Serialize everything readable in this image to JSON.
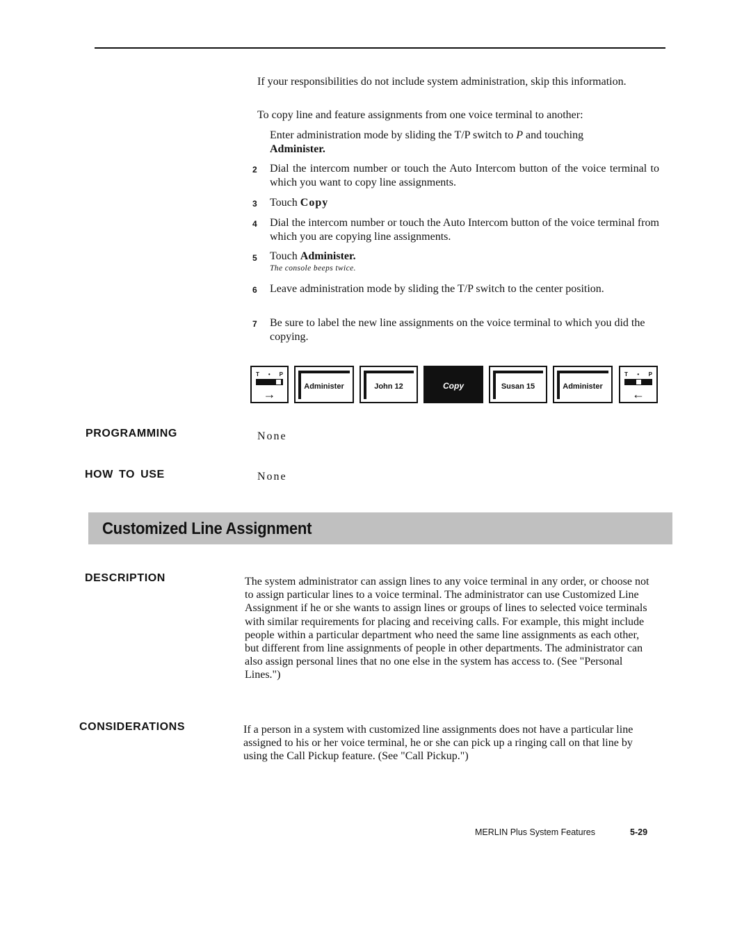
{
  "intro": {
    "skip_note": "If your responsibilities do not include system administration, skip this information.",
    "lead": "To copy line and feature assignments from one voice terminal to another:"
  },
  "steps": [
    {
      "num": "",
      "text_before": "Enter administration mode by sliding the T/P switch to ",
      "italic": "P",
      "text_after": " and  touching ",
      "bold": "Administer."
    },
    {
      "num": "2",
      "text": "Dial the intercom number or touch the Auto Intercom button of the voice terminal to which you want to copy line assignments."
    },
    {
      "num": "3",
      "prefix": "Touch ",
      "bold": "Copy"
    },
    {
      "num": "4",
      "text": "Dial the intercom number or touch the Auto Intercom button of the voice terminal from which you are copying line assignments."
    },
    {
      "num": "5",
      "prefix": "Touch ",
      "bold": "Administer.",
      "note": "The console beeps twice."
    },
    {
      "num": "6",
      "text": "Leave administration mode by sliding the T/P switch to the center position."
    },
    {
      "num": "7",
      "text": "Be sure to label the new line assignments on the voice terminal to which you did the copying."
    }
  ],
  "key_sequence": {
    "switch_labels": [
      "T",
      "•",
      "P"
    ],
    "start_switch": {
      "position": "P",
      "arrow": "→"
    },
    "buttons": [
      "Administer",
      "John 12",
      "Copy",
      "Susan 15",
      "Administer"
    ],
    "end_switch": {
      "position": "center",
      "arrow": "←"
    }
  },
  "sections": {
    "programming": {
      "label": "PROGRAMMING",
      "value": "None"
    },
    "how_to_use": {
      "label": "HOW  TO  USE",
      "value": "None"
    }
  },
  "feature": {
    "title": "Customized Line Assignment",
    "description_label": "DESCRIPTION",
    "description": "The system administrator can assign lines to any voice terminal in any order, or choose not to assign particular lines to a voice terminal. The administrator can use Customized Line Assignment if he or she wants to assign lines or groups of lines to selected voice terminals with similar requirements for placing and receiving calls. For example, this might include people within a particular department who need the same line assignments as each other, but different from line assignments of people in other departments. The administrator can also assign personal lines that no one else in the system has access to. (See \"Personal  Lines.\")",
    "considerations_label": "CONSIDERATIONS",
    "considerations": "If a person in a system with customized line assignments does not have a particular line assigned to his or her voice terminal, he or she can pick up a ringing call on that line by using the Call Pickup feature. (See \"Call Pickup.\")"
  },
  "footer": {
    "book": "MERLIN Plus System Features",
    "page": "5-29"
  }
}
